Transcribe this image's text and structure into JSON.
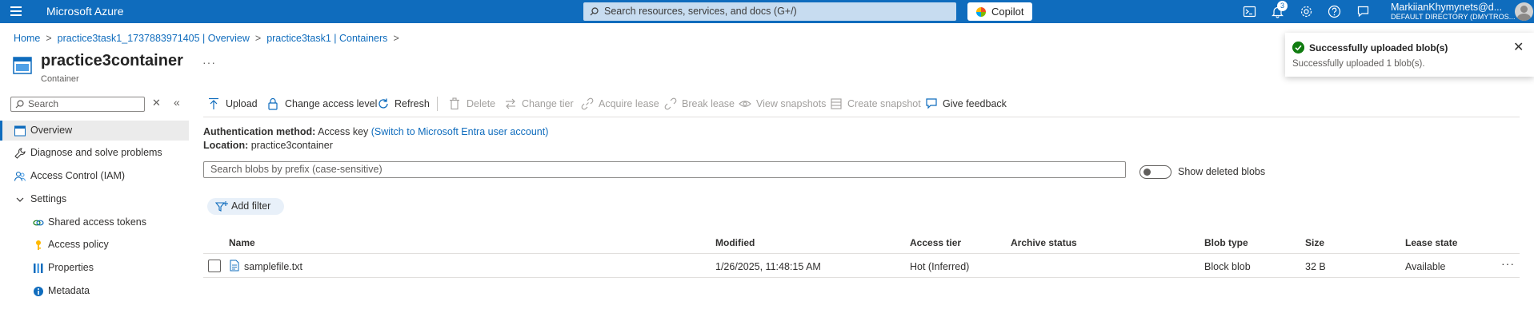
{
  "topbar": {
    "brand": "Microsoft Azure",
    "search_placeholder": "Search resources, services, and docs (G+/)",
    "copilot_label": "Copilot",
    "notification_count": "3",
    "user_name": "MarkiianKhymynets@d...",
    "user_directory": "DEFAULT DIRECTORY (DMYTROS..."
  },
  "breadcrumb": {
    "items": [
      "Home",
      "practice3task1_1737883971405 | Overview",
      "practice3task1 | Containers"
    ]
  },
  "header": {
    "title": "practice3container",
    "subtitle": "Container",
    "more": "···"
  },
  "sidebar": {
    "search_placeholder": "Search",
    "items": [
      {
        "label": "Overview",
        "icon": "container-icon"
      },
      {
        "label": "Diagnose and solve problems",
        "icon": "wrench-icon"
      },
      {
        "label": "Access Control (IAM)",
        "icon": "people-icon"
      },
      {
        "label": "Settings",
        "icon": "chevron-down-icon"
      },
      {
        "label": "Shared access tokens",
        "icon": "link-icon"
      },
      {
        "label": "Access policy",
        "icon": "key-icon"
      },
      {
        "label": "Properties",
        "icon": "properties-icon"
      },
      {
        "label": "Metadata",
        "icon": "info-icon"
      }
    ]
  },
  "commands": {
    "upload": "Upload",
    "change_access_level": "Change access level",
    "refresh": "Refresh",
    "delete": "Delete",
    "change_tier": "Change tier",
    "acquire_lease": "Acquire lease",
    "break_lease": "Break lease",
    "view_snapshots": "View snapshots",
    "create_snapshot": "Create snapshot",
    "give_feedback": "Give feedback"
  },
  "info": {
    "auth_label": "Authentication method:",
    "auth_value": "Access key",
    "auth_link": "(Switch to Microsoft Entra user account)",
    "location_label": "Location:",
    "location_value": "practice3container"
  },
  "filters": {
    "blob_search_placeholder": "Search blobs by prefix (case-sensitive)",
    "show_deleted_label": "Show deleted blobs",
    "show_deleted_on": false,
    "add_filter": "Add filter"
  },
  "table": {
    "columns": [
      "Name",
      "Modified",
      "Access tier",
      "Archive status",
      "Blob type",
      "Size",
      "Lease state"
    ],
    "rows": [
      {
        "name": "samplefile.txt",
        "modified": "1/26/2025, 11:48:15 AM",
        "access_tier": "Hot (Inferred)",
        "archive_status": "",
        "blob_type": "Block blob",
        "size": "32 B",
        "lease_state": "Available"
      }
    ]
  },
  "toast": {
    "title": "Successfully uploaded blob(s)",
    "message": "Successfully uploaded 1 blob(s)."
  },
  "colors": {
    "accent": "#0f6cbd",
    "success": "#107c10"
  }
}
